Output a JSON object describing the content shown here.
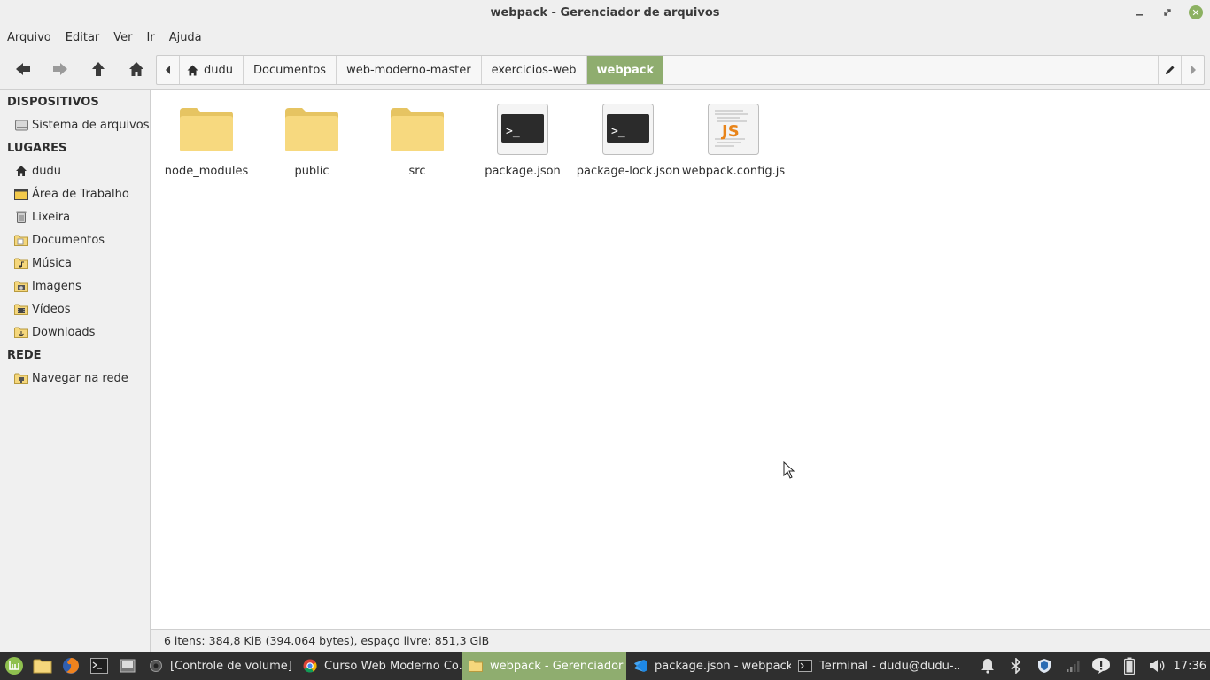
{
  "window": {
    "title": "webpack - Gerenciador de arquivos"
  },
  "menu": [
    "Arquivo",
    "Editar",
    "Ver",
    "Ir",
    "Ajuda"
  ],
  "pathbar": {
    "crumbs": [
      "dudu",
      "Documentos",
      "web-moderno-master",
      "exercicios-web",
      "webpack"
    ]
  },
  "sidebar": {
    "dispositivos": {
      "title": "DISPOSITIVOS",
      "items": [
        "Sistema de arquivos"
      ]
    },
    "lugares": {
      "title": "LUGARES",
      "items": [
        "dudu",
        "Área de Trabalho",
        "Lixeira",
        "Documentos",
        "Música",
        "Imagens",
        "Vídeos",
        "Downloads"
      ]
    },
    "rede": {
      "title": "REDE",
      "items": [
        "Navegar na rede"
      ]
    }
  },
  "files": [
    {
      "name": "node_modules",
      "icon": "folder-icon"
    },
    {
      "name": "public",
      "icon": "folder-icon"
    },
    {
      "name": "src",
      "icon": "folder-icon"
    },
    {
      "name": "package.json",
      "icon": "terminal-file-icon"
    },
    {
      "name": "package-lock.json",
      "icon": "terminal-file-icon"
    },
    {
      "name": "webpack.config.js",
      "icon": "javascript-file-icon"
    }
  ],
  "status": "6 itens: 384,8 KiB (394.064 bytes), espaço livre: 851,3 GiB",
  "taskbar": {
    "tasks": [
      "[Controle de volume]",
      "Curso Web Moderno Co...",
      "webpack - Gerenciador ...",
      "package.json - webpack ...",
      "Terminal - dudu@dudu-..."
    ],
    "clock": "17:36"
  },
  "colors": {
    "accent": "#8fad6f",
    "taskbar": "#2f2f2f",
    "folder": "#f5d77c"
  }
}
